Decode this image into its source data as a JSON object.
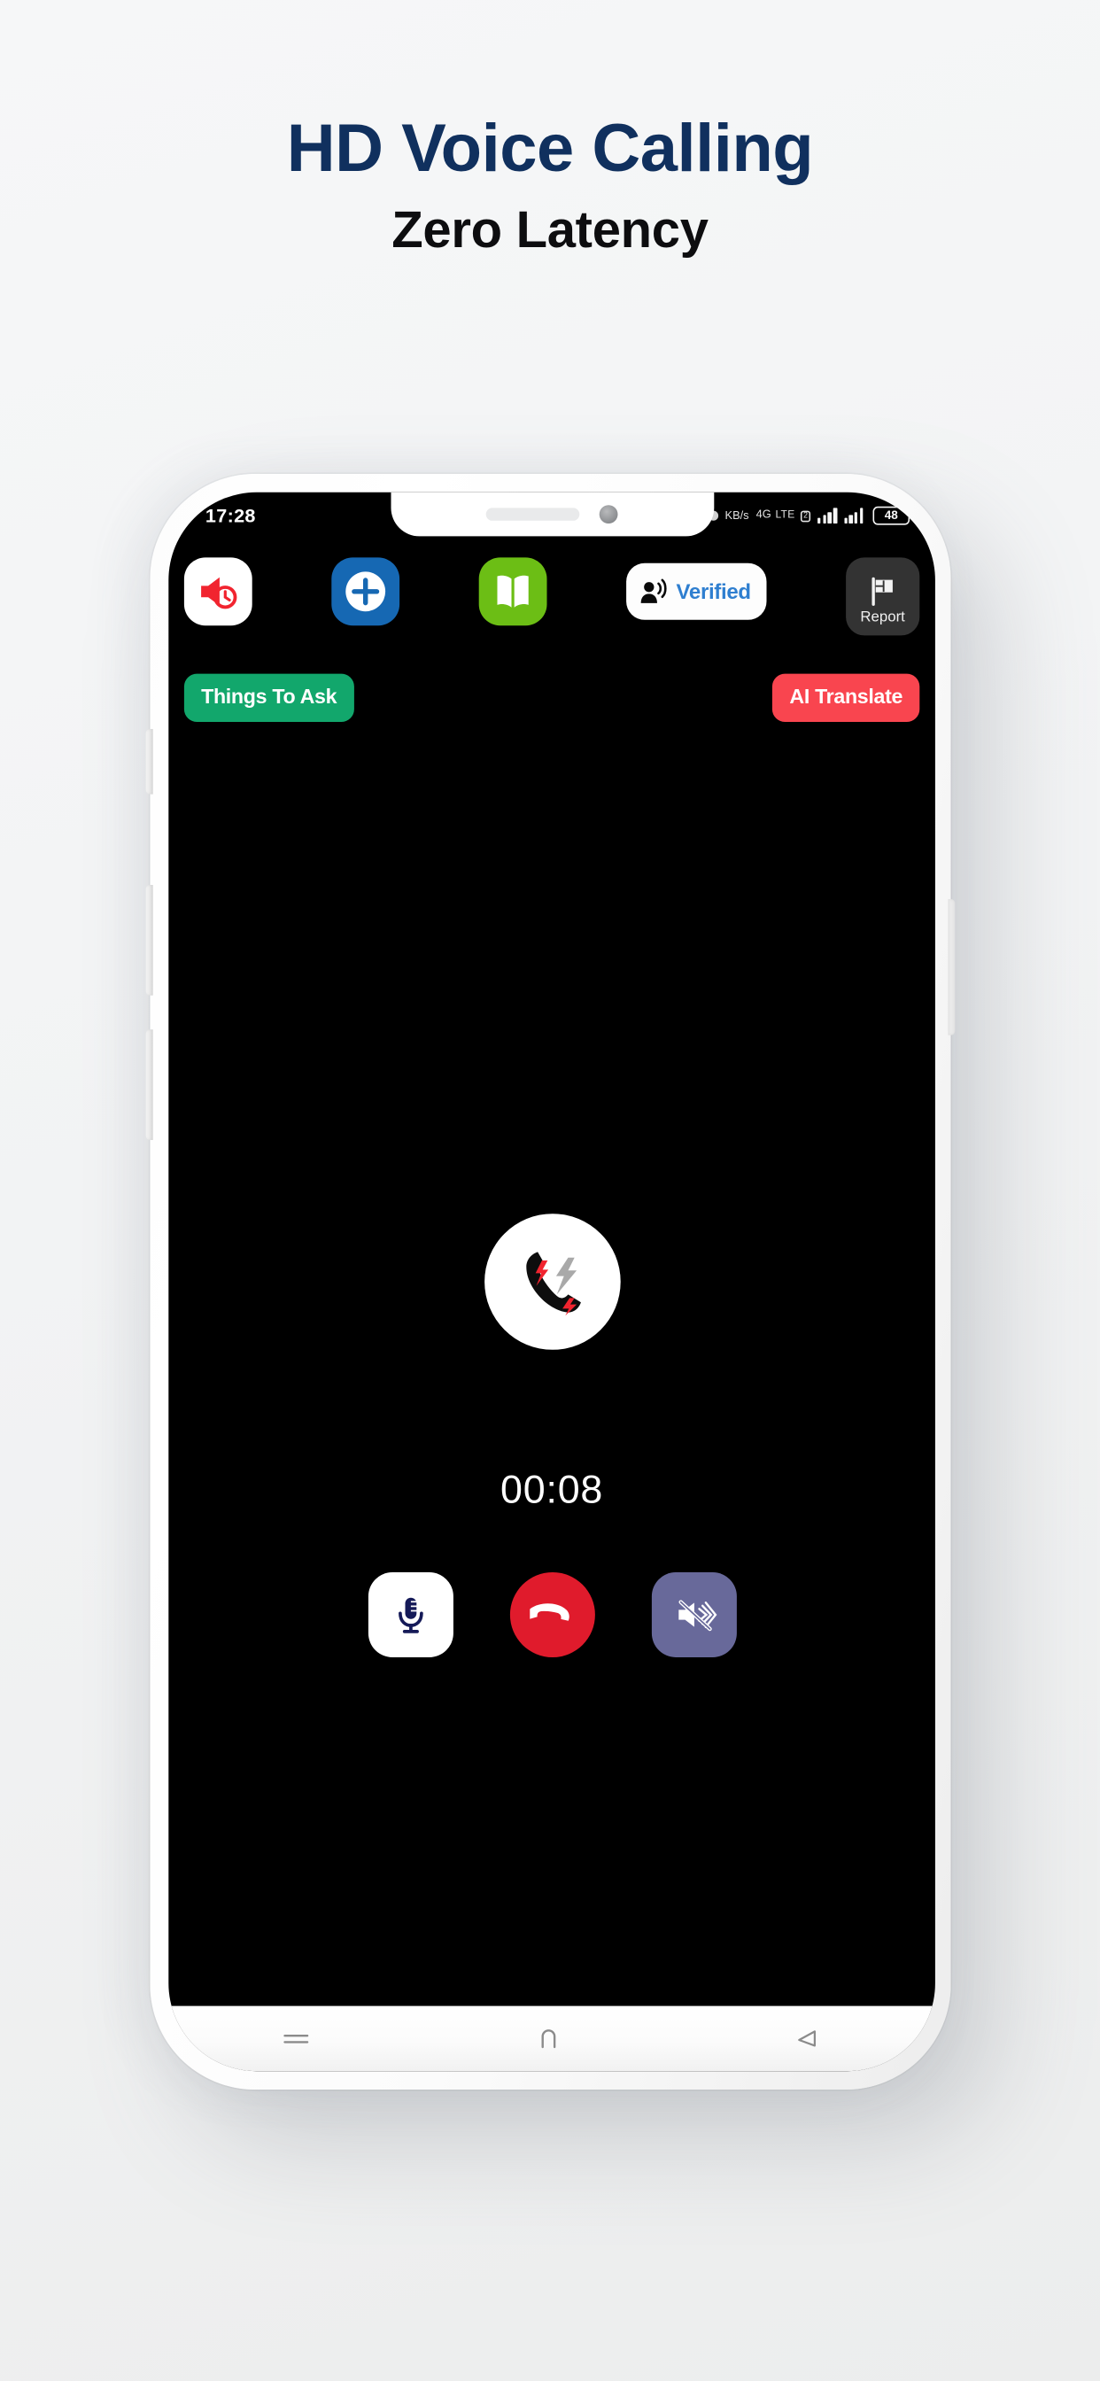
{
  "promo": {
    "headline": "HD Voice Calling",
    "subheadline": "Zero Latency",
    "headline_color": "#10305e",
    "subheadline_color": "#0d0d0f",
    "background_color": "#f4f5f6"
  },
  "phone": {
    "status_bar": {
      "time": "17:28",
      "network_rate_unit": "KB/s",
      "network_type": "4G",
      "network_label": "LTE",
      "sim_badge": "2",
      "battery_percent": "48"
    },
    "top_actions": [
      {
        "name": "mute-ringtone",
        "icon": "megaphone-clock-icon",
        "tile_color": "#ffffff",
        "label": ""
      },
      {
        "name": "add-call",
        "icon": "plus-circle-icon",
        "tile_color": "#1668b3",
        "label": ""
      },
      {
        "name": "open-directory",
        "icon": "open-book-icon",
        "tile_color": "#6cbe15",
        "label": ""
      },
      {
        "name": "verified-badge",
        "icon": "person-speaking-icon",
        "tile_color": "#fdfdfd",
        "label": "Verified",
        "label_color": "#2f7fd0"
      },
      {
        "name": "report-call",
        "icon": "flag-icon",
        "tile_color": "#333333",
        "label": "Report",
        "label_color": "#f0f0f0"
      }
    ],
    "mid_actions": {
      "things_to_ask": {
        "label": "Things To Ask",
        "color": "#12a76c"
      },
      "ai_translate": {
        "label": "AI Translate",
        "color": "#f9454f"
      },
      "avatar_icon": "phone-handset-lightning-icon"
    },
    "call": {
      "duration": "00:08",
      "controls": [
        {
          "name": "mute-microphone",
          "icon": "microphone-icon",
          "color": "#ffffff"
        },
        {
          "name": "end-call",
          "icon": "phone-hangup-icon",
          "color": "#e01b2c"
        },
        {
          "name": "speaker-toggle",
          "icon": "speaker-muted-icon",
          "color": "#68699a"
        }
      ]
    },
    "nav_bar": [
      {
        "name": "recents-button",
        "icon": "recents-lines-icon"
      },
      {
        "name": "home-button",
        "icon": "home-arch-icon"
      },
      {
        "name": "back-button",
        "icon": "back-arrow-icon"
      }
    ]
  }
}
